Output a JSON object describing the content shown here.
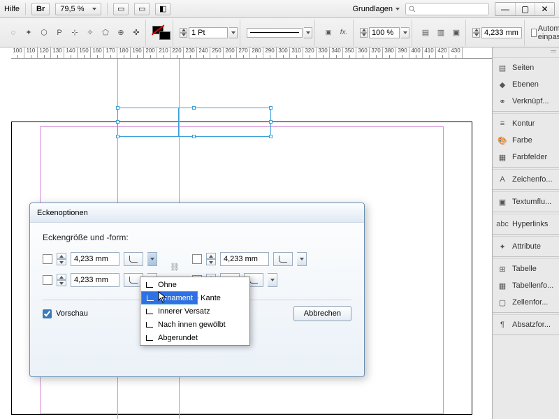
{
  "menubar": {
    "help": "Hilfe",
    "br_label": "Br",
    "zoom": "79,5 %",
    "workspace_label": "Grundlagen"
  },
  "window_controls": {
    "min": "—",
    "max": "▢",
    "close": "✕"
  },
  "toolbar": {
    "stroke_weight": "1 Pt",
    "scale_percent": "100 %",
    "corner_size": "4,233 mm",
    "autofit_label": "Automatisch einpassen"
  },
  "ruler_start": 100,
  "ruler_step": 10,
  "ruler_count": 34,
  "dialog": {
    "title": "Eckenoptionen",
    "label": "Eckengröße und -form:",
    "value": "4,233 mm",
    "preview": "Vorschau",
    "cancel": "Abbrechen"
  },
  "dropdown": {
    "items": [
      "Ohne",
      "Ornament",
      "Abgeflachte Kante",
      "Innerer Versatz",
      "Nach innen gewölbt",
      "Abgerundet"
    ],
    "selected_index": 1
  },
  "panels": [
    [
      {
        "icon": "pages",
        "label": "Seiten"
      },
      {
        "icon": "layers",
        "label": "Ebenen"
      },
      {
        "icon": "links",
        "label": "Verknüpf..."
      }
    ],
    [
      {
        "icon": "stroke",
        "label": "Kontur"
      },
      {
        "icon": "color",
        "label": "Farbe"
      },
      {
        "icon": "swatches",
        "label": "Farbfelder"
      }
    ],
    [
      {
        "icon": "char",
        "label": "Zeichenfo..."
      }
    ],
    [
      {
        "icon": "textwrap",
        "label": "Textumflu..."
      }
    ],
    [
      {
        "icon": "hyperlink",
        "label": "Hyperlinks"
      }
    ],
    [
      {
        "icon": "attrib",
        "label": "Attribute"
      }
    ],
    [
      {
        "icon": "table",
        "label": "Tabelle"
      },
      {
        "icon": "tablefmt",
        "label": "Tabellenfo..."
      },
      {
        "icon": "cellfmt",
        "label": "Zellenfor..."
      }
    ],
    [
      {
        "icon": "para",
        "label": "Absatzfor..."
      }
    ]
  ]
}
